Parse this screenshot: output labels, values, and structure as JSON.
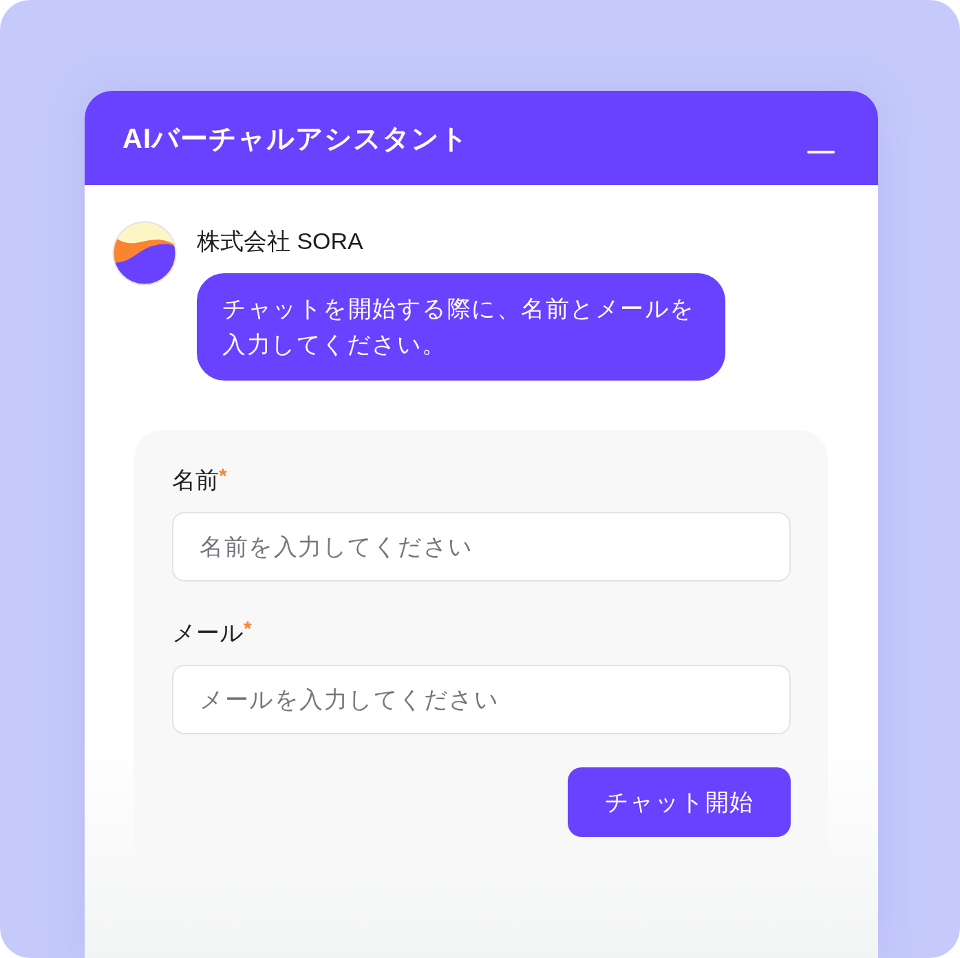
{
  "widget": {
    "title": "AIバーチャルアシスタント"
  },
  "message": {
    "sender": "株式会社 SORA",
    "text": "チャットを開始する際に、名前とメールを入力してください。"
  },
  "form": {
    "fields": [
      {
        "label": "名前",
        "required_mark": "*",
        "placeholder": "名前を入力してください"
      },
      {
        "label": "メール",
        "required_mark": "*",
        "placeholder": "メールを入力してください"
      }
    ],
    "submit_button": "チャット開始"
  }
}
